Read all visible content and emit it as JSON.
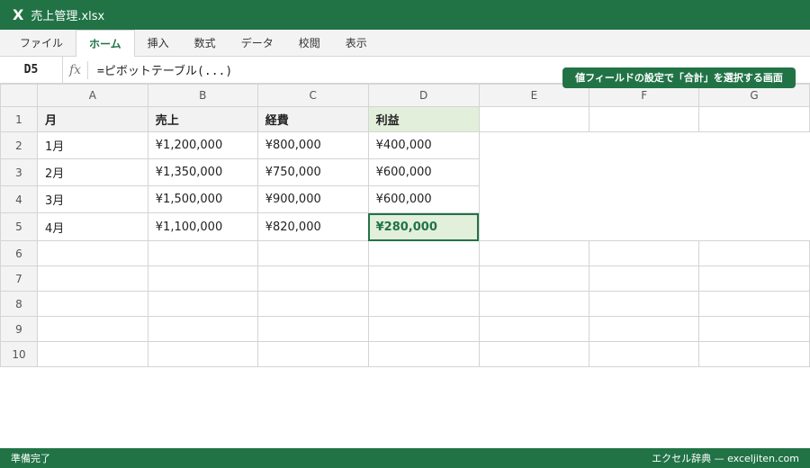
{
  "titlebar": {
    "icon": "X",
    "title": "売上管理.xlsx"
  },
  "ribbon": {
    "tabs": [
      "ファイル",
      "ホーム",
      "挿入",
      "数式",
      "データ",
      "校閲",
      "表示"
    ],
    "active": 1
  },
  "formulabar": {
    "cell_ref": "D5",
    "fx": "fx",
    "formula": "=ピボットテーブル(...)"
  },
  "callout": "値フィールドの設定で「合計」を選択する画面",
  "grid": {
    "columns": [
      "A",
      "B",
      "C",
      "D",
      "E",
      "F",
      "G"
    ],
    "rows": [
      "1",
      "2",
      "3",
      "4",
      "5",
      "6",
      "7",
      "8",
      "9",
      "10"
    ],
    "header": [
      "月",
      "売上",
      "経費",
      "利益"
    ],
    "data": [
      [
        "1月",
        "¥1,200,000",
        "¥800,000",
        "¥400,000"
      ],
      [
        "2月",
        "¥1,350,000",
        "¥750,000",
        "¥600,000"
      ],
      [
        "3月",
        "¥1,500,000",
        "¥900,000",
        "¥600,000"
      ],
      [
        "4月",
        "¥1,100,000",
        "¥820,000",
        "¥280,000"
      ]
    ]
  },
  "statusbar": {
    "left": "準備完了",
    "right": "エクセル辞典 — exceljiten.com"
  },
  "colors": {
    "accent": "#217346",
    "highlight": "#e2efda"
  }
}
